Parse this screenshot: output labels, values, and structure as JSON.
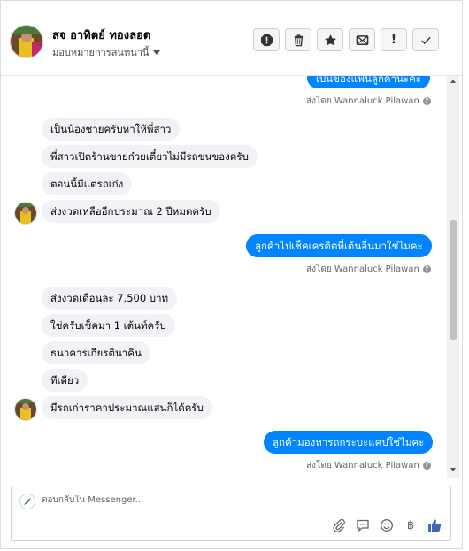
{
  "header": {
    "name": "สจ อาทิตย์ ทองลอด",
    "assign_label": "มอบหมายการสนทนานี้"
  },
  "actions": [
    {
      "icon": "spam-alert-icon"
    },
    {
      "icon": "trash-icon"
    },
    {
      "icon": "star-icon"
    },
    {
      "icon": "mark-unread-icon"
    },
    {
      "icon": "exclamation-icon"
    },
    {
      "icon": "check-done-icon"
    }
  ],
  "messages": {
    "m0": "เป็นของแฟนลูกค้านะคะ",
    "s0": "ส่งโดย Wannaluck Pilawan",
    "m1": "เป็นน้องชายครับหาให้พี่สาว",
    "m2": "พี่สาวเปิดร้านขายก๋วยเตี๋ยวไม่มีรถขนของครับ",
    "m3": "ตอนนี้มีแต่รถเก๋ง",
    "m4": "ส่งงวดเหลืออีกประมาณ 2 ปีหมดครับ",
    "m5": "ลูกค้าไปเช็คเครดิตที่เต้นอื่นมาใช่ไมคะ",
    "s5": "ส่งโดย Wannaluck Pilawan",
    "m6": "ส่งงวดเดือนละ 7,500 บาท",
    "m7": "ใช่ครับเช็คมา 1 เต้นท์ครับ",
    "m8": "ธนาคารเกียรตินาคิน",
    "m9": "ทีเดียว",
    "m10": "มีรถเก่าราคาประมาณแสนก็ได้ครับ",
    "m11": "ลูกค้ามองหารถกระบะแคปใช่ไมคะ",
    "s11": "ส่งโดย Wannaluck Pilawan"
  },
  "reply": {
    "placeholder": "ตอบกลับใน Messenger..."
  },
  "tools": {
    "baht_symbol": "฿"
  },
  "colors": {
    "outgoing": "#0084ff",
    "incoming": "#f0f2f5",
    "like": "#4267b2"
  }
}
